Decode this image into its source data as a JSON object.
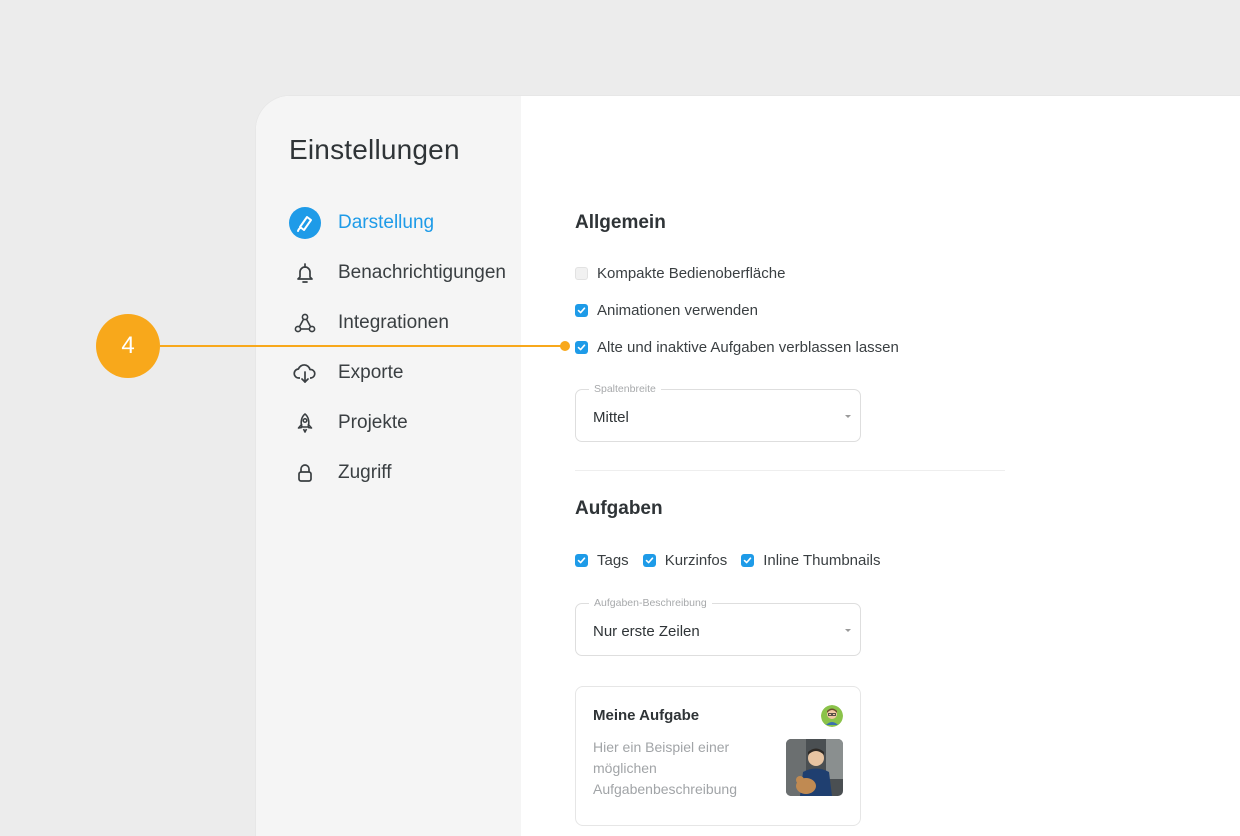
{
  "sidebar": {
    "title": "Einstellungen",
    "items": [
      {
        "label": "Darstellung",
        "icon": "paint-brush-icon",
        "active": true
      },
      {
        "label": "Benachrichtigungen",
        "icon": "bell-icon"
      },
      {
        "label": "Integrationen",
        "icon": "network-icon"
      },
      {
        "label": "Exporte",
        "icon": "cloud-download-icon"
      },
      {
        "label": "Projekte",
        "icon": "rocket-icon"
      },
      {
        "label": "Zugriff",
        "icon": "lock-icon"
      }
    ]
  },
  "general": {
    "title": "Allgemein",
    "options": [
      {
        "label": "Kompakte Bedienoberfläche",
        "checked": false
      },
      {
        "label": "Animationen verwenden",
        "checked": true
      },
      {
        "label": "Alte und inaktive Aufgaben verblassen lassen",
        "checked": true
      }
    ],
    "column_width": {
      "label": "Spaltenbreite",
      "value": "Mittel"
    }
  },
  "tasks": {
    "title": "Aufgaben",
    "options": [
      {
        "label": "Tags",
        "checked": true
      },
      {
        "label": "Kurzinfos",
        "checked": true
      },
      {
        "label": "Inline Thumbnails",
        "checked": true
      }
    ],
    "description_select": {
      "label": "Aufgaben-Beschreibung",
      "value": "Nur erste Zeilen"
    },
    "example_card": {
      "title": "Meine Aufgabe",
      "description": "Hier ein Beispiel einer möglichen Aufgabenbeschreibung"
    }
  },
  "annotation": {
    "number": "4"
  },
  "colors": {
    "accent": "#1e9be8",
    "annotation": "#f8a81b",
    "sidebar_bg": "#f5f5f5",
    "page_bg": "#ececec"
  }
}
